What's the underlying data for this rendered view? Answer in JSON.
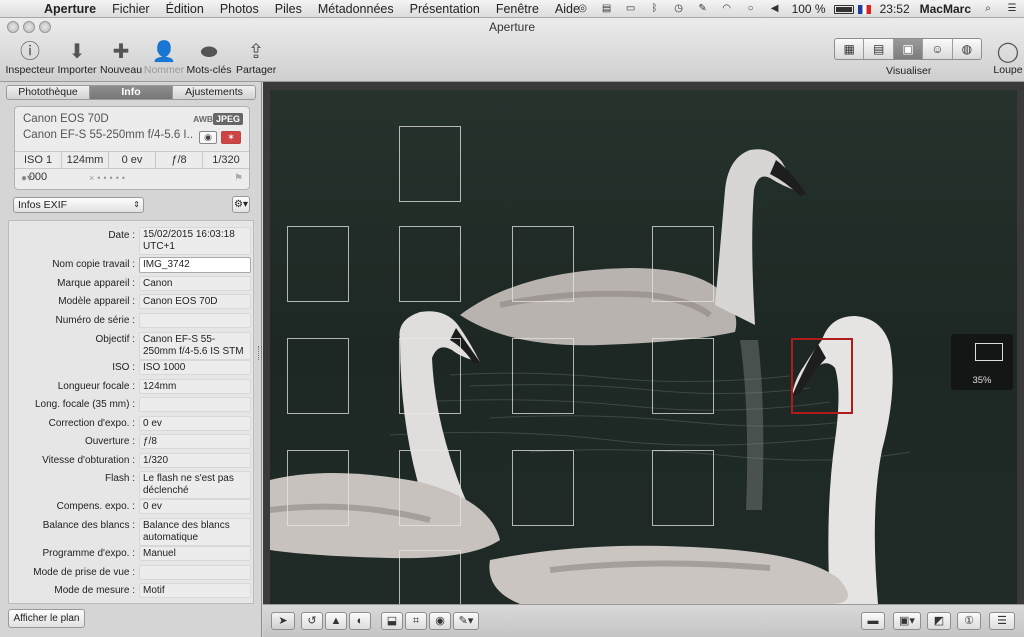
{
  "menubar": {
    "app": "Aperture",
    "items": [
      "Fichier",
      "Édition",
      "Photos",
      "Piles",
      "Métadonnées",
      "Présentation",
      "Fenêtre",
      "Aide"
    ],
    "battery": "100 %",
    "time": "23:52",
    "user": "MacMarc"
  },
  "window": {
    "title": "Aperture"
  },
  "toolbar": {
    "inspector": "Inspecteur",
    "import": "Importer",
    "new": "Nouveau",
    "name": "Nommer",
    "keywords": "Mots-clés",
    "share": "Partager",
    "view": "Visualiser",
    "loupe": "Loupe"
  },
  "inspector": {
    "tabs": [
      "Photothèque",
      "Info",
      "Ajustements"
    ],
    "camera": {
      "model": "Canon EOS 70D",
      "lens": "Canon EF-S 55-250mm f/4-5.6 I...",
      "awb": "AWB",
      "format": "JPEG",
      "iso": "ISO 1 000",
      "focal": "124mm",
      "ev": "0 ev",
      "aperture": "ƒ/8",
      "shutter": "1/320"
    },
    "preset": "Infos EXIF",
    "exif": [
      {
        "label": "Date :",
        "value": "15/02/2015 16:03:18 UTC+1"
      },
      {
        "label": "Nom copie travail :",
        "value": "IMG_3742"
      },
      {
        "label": "Marque appareil :",
        "value": "Canon"
      },
      {
        "label": "Modèle appareil :",
        "value": "Canon EOS 70D"
      },
      {
        "label": "Numéro de série :",
        "value": ""
      },
      {
        "label": "Objectif :",
        "value": "Canon EF-S 55-250mm f/4-5.6 IS STM"
      },
      {
        "label": "ISO :",
        "value": "ISO 1000"
      },
      {
        "label": "Longueur focale :",
        "value": "124mm"
      },
      {
        "label": "Long. focale (35 mm) :",
        "value": ""
      },
      {
        "label": "Correction d'expo. :",
        "value": "0 ev"
      },
      {
        "label": "Ouverture :",
        "value": "ƒ/8"
      },
      {
        "label": "Vitesse d'obturation :",
        "value": "1/320"
      },
      {
        "label": "Flash :",
        "value": "Le flash ne s'est pas déclenché"
      },
      {
        "label": "Compens. expo. :",
        "value": "0 ev"
      },
      {
        "label": "Balance des blancs :",
        "value": "Balance des blancs automatique"
      },
      {
        "label": "Programme d'expo. :",
        "value": "Manuel"
      },
      {
        "label": "Mode de prise de vue :",
        "value": ""
      },
      {
        "label": "Mode de mesure :",
        "value": "Motif"
      }
    ],
    "plan_button": "Afficher le plan"
  },
  "viewer": {
    "zoom": "35%"
  },
  "colors": {
    "selected_af_point": "#b01b1b",
    "active_tab": "#7f7f7f"
  }
}
